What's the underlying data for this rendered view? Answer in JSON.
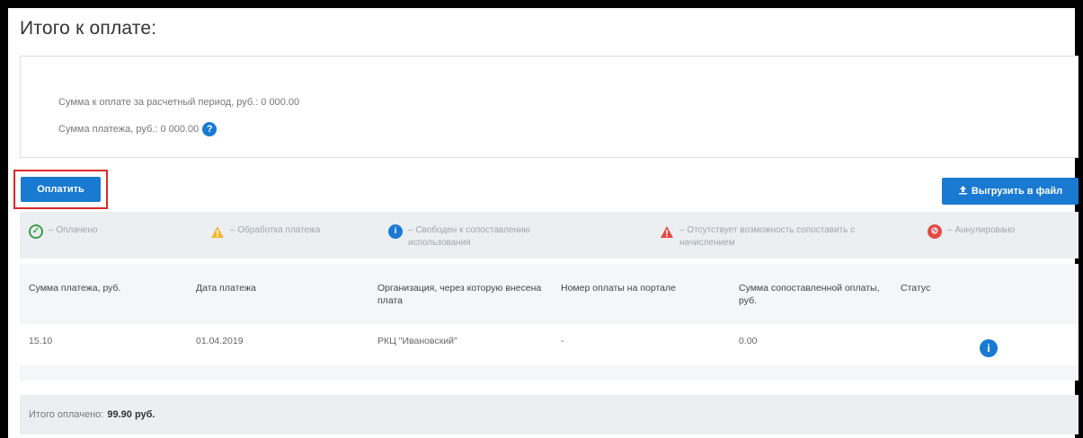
{
  "title": "Итого к оплате:",
  "summary": {
    "line1": "Сумма к оплате за расчетный период, руб.: 0 000.00",
    "line2": "Сумма платежа, руб.: 0 000.00"
  },
  "buttons": {
    "pay": "Оплатить",
    "export": "Выгрузить в файл"
  },
  "legend": [
    {
      "icon": "check-circle-icon",
      "text": "– Оплачено"
    },
    {
      "icon": "warning-icon",
      "text": "– Обработка платежа"
    },
    {
      "icon": "info-icon",
      "text": "– Свободен к сопоставлению использования"
    },
    {
      "icon": "warning-red-icon",
      "text": "– Отсутствует возможность сопоставить с начислением"
    },
    {
      "icon": "cancel-icon",
      "text": "– Аннулировано"
    }
  ],
  "table": {
    "headers": [
      "Сумма платежа, руб.",
      "Дата платежа",
      "Организация, через которую внесена плата",
      "Номер оплаты на портале",
      "Сумма сопоставленной оплаты, руб.",
      "Статус"
    ],
    "rows": [
      {
        "amount": "15.10",
        "date": "01.04.2019",
        "org": "РКЦ \"Ивановский\"",
        "number": "-",
        "matched": "0.00"
      }
    ]
  },
  "total": {
    "label": "Итого оплачено:",
    "value": "99.90 руб."
  },
  "colors": {
    "accent": "#1a7ad1",
    "highlight": "#d9292b",
    "paid": "#3aa04a",
    "warning": "#f2b631",
    "error": "#e24b45"
  }
}
